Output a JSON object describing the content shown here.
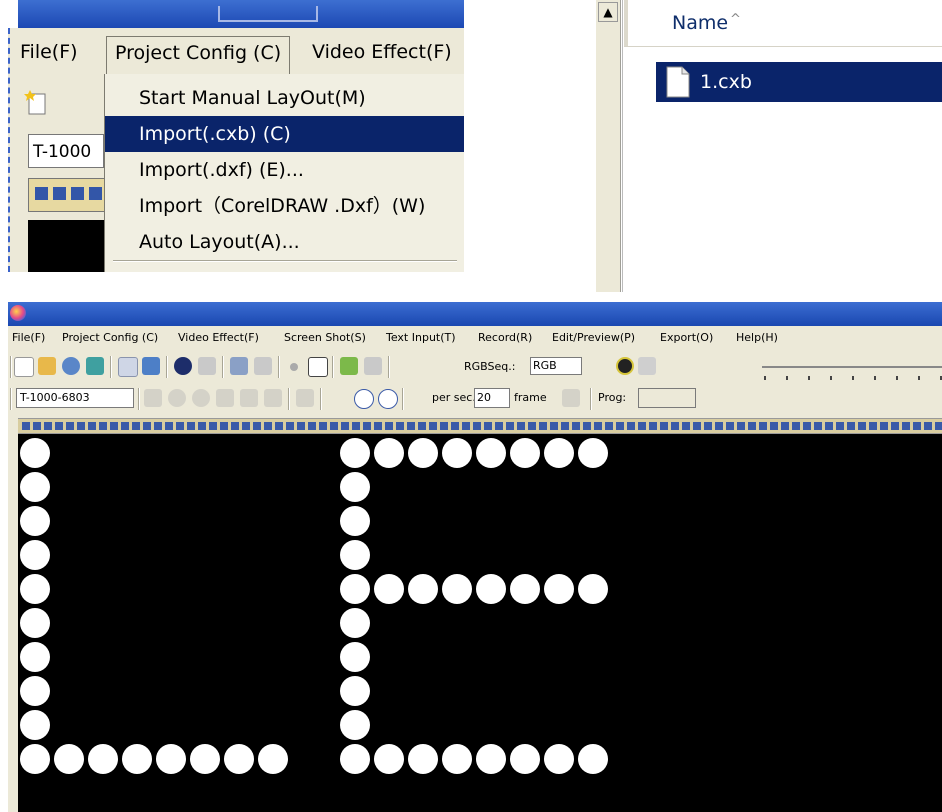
{
  "crop_menu": {
    "menubar": {
      "file": "File(F)",
      "project_config": "Project Config (C)",
      "video_effect": "Video Effect(F)"
    },
    "project_field": "T-1000",
    "dropdown_items": [
      "Start Manual LayOut(M)",
      "Import(.cxb) (C)",
      "Import(.dxf) (E)...",
      "Import（CorelDRAW .Dxf）(W)",
      "Auto Layout(A)..."
    ],
    "selected_index": 1
  },
  "explorer": {
    "column_header": "Name",
    "sort_indicator": "^",
    "files": [
      {
        "name": "1.cxb",
        "selected": true
      }
    ]
  },
  "app": {
    "menu": [
      "File(F)",
      "Project Config (C)",
      "Video Effect(F)",
      "Screen Shot(S)",
      "Text Input(T)",
      "Record(R)",
      "Edit/Preview(P)",
      "Export(O)",
      "Help(H)"
    ],
    "rgb_label": "RGBSeq.:",
    "rgb_value": "RGB",
    "project_id": "T-1000-6803",
    "per_sec_label": "per sec.",
    "speed_value": "20",
    "frame_label": "frame",
    "prog_label": "Prog:",
    "prog_value": ""
  }
}
